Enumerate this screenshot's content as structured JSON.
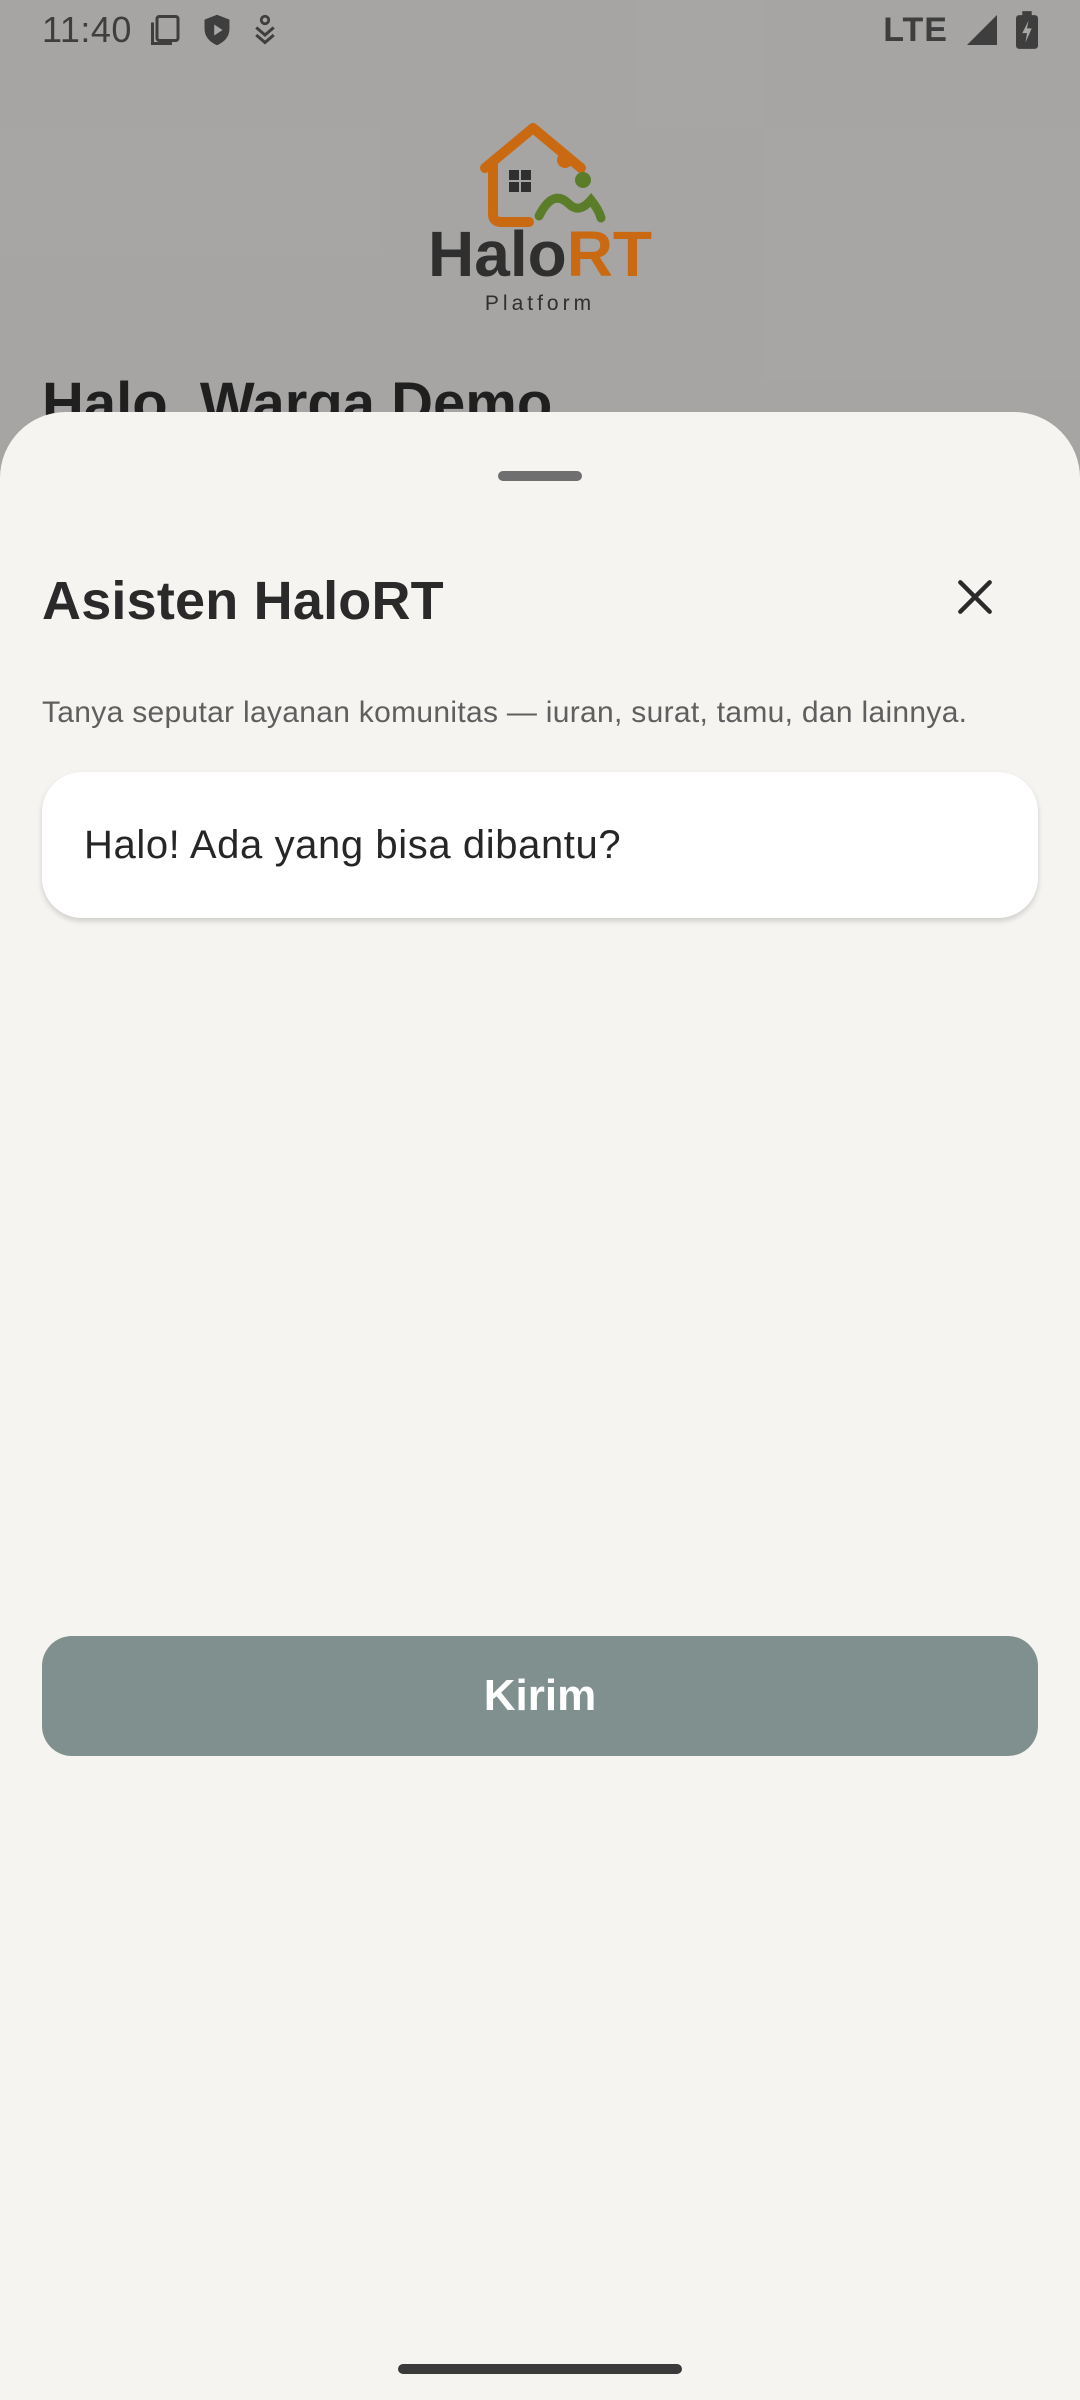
{
  "status_bar": {
    "time": "11:40",
    "network": "LTE",
    "icons": [
      "sim-card-icon",
      "shield-play-icon",
      "download-icon",
      "signal-icon",
      "battery-charging-icon"
    ]
  },
  "background_screen": {
    "logo": {
      "word_part1": "Halo",
      "word_part2": "RT",
      "subtitle": "Platform",
      "colors": {
        "house": "#c96a12",
        "person": "#5b7d2a",
        "text": "#2f2f2f"
      }
    },
    "greeting": "Halo, Warga Demo"
  },
  "sheet": {
    "title": "Asisten HaloRT",
    "description": "Tanya seputar layanan komunitas — iuran, surat, tamu, dan lainnya.",
    "message_text": "Halo! Ada yang bisa dibantu?",
    "send_label": "Kirim",
    "close_icon": "close-icon",
    "colors": {
      "background": "#f6f4f1",
      "send_button": "#7f908e",
      "bubble": "#ffffff"
    }
  }
}
